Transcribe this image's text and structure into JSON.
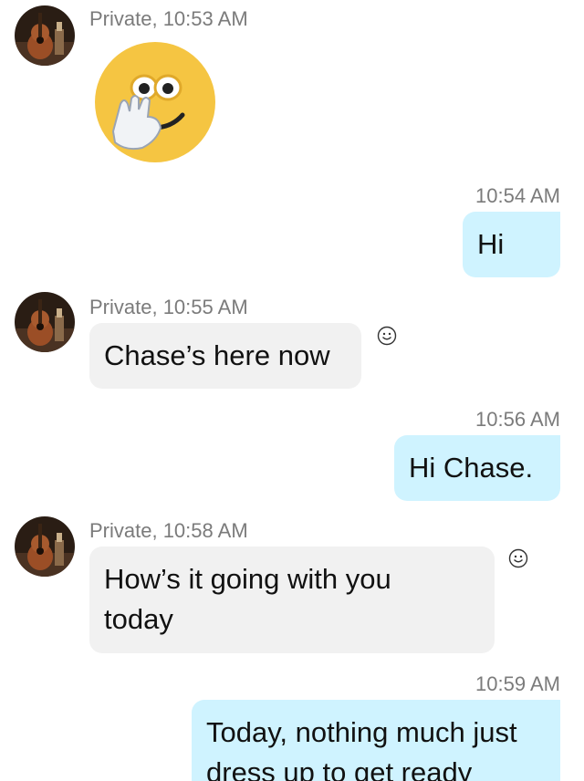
{
  "colors": {
    "incoming_bubble": "#f1f1f1",
    "outgoing_bubble": "#cff3ff",
    "meta_text": "#7b7b7b",
    "sticker_face": "#f5c542"
  },
  "messages": [
    {
      "sender": "Private",
      "time": "Private, 10:53 AM",
      "type": "sticker",
      "sticker": "hand-over-mouth-emoji-sticker"
    },
    {
      "sender": "me",
      "time": "10:54 AM",
      "type": "text",
      "text": "Hi"
    },
    {
      "sender": "Private",
      "time": "Private, 10:55 AM",
      "type": "text",
      "text": "Chase’s here now"
    },
    {
      "sender": "me",
      "time": "10:56 AM",
      "type": "text",
      "text": "Hi Chase."
    },
    {
      "sender": "Private",
      "time": "Private, 10:58 AM",
      "type": "text",
      "text_lines": [
        "How’s it going with you",
        "today"
      ]
    },
    {
      "sender": "me",
      "time": "10:59 AM",
      "type": "text",
      "text_lines": [
        "Today, nothing much just",
        "dress up to get ready"
      ]
    }
  ],
  "icons": {
    "avatar": "guitar-avatar",
    "reaction": "smiley-reaction-icon"
  }
}
